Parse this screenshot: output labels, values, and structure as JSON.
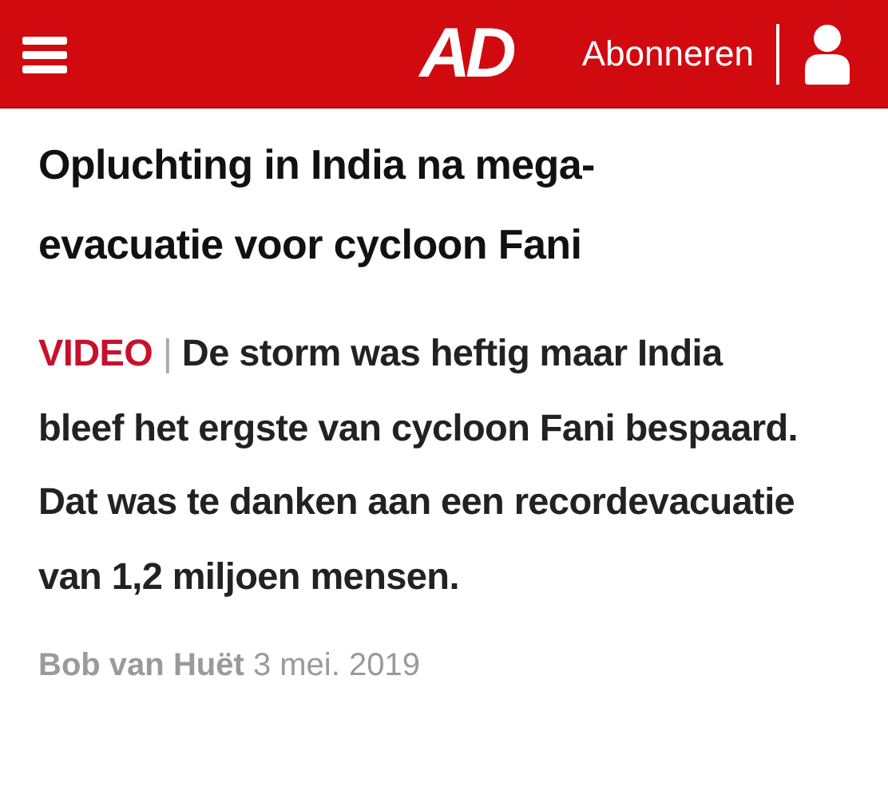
{
  "header": {
    "logo": "AD",
    "subscribe": "Abonneren"
  },
  "article": {
    "title": "Opluchting in India na mega-evacuatie voor cycloon Fani",
    "label": "VIDEO",
    "separator": "|",
    "lede": "De storm was heftig maar India bleef het ergste van cycloon Fani bespaard. Dat was te danken aan een recordevacuatie van 1,2 miljoen mensen.",
    "author": "Bob van Huët",
    "date": "3 mei. 2019"
  }
}
